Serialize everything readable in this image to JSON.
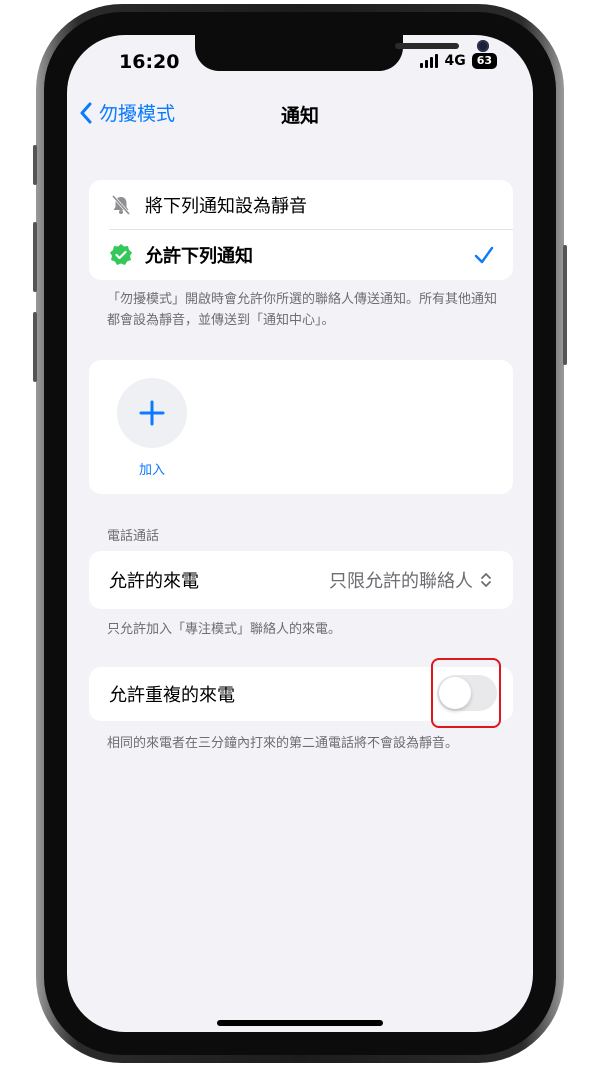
{
  "status": {
    "time": "16:20",
    "network": "4G",
    "battery": "63"
  },
  "nav": {
    "back_label": "勿擾模式",
    "title": "通知"
  },
  "mode_options": [
    {
      "label": "將下列通知設為靜音",
      "icon": "bell-slash-icon",
      "selected": false
    },
    {
      "label": "允許下列通知",
      "icon": "checkmark-seal-icon",
      "selected": true
    }
  ],
  "mode_footnote": "「勿擾模式」開啟時會允許你所選的聯絡人傳送通知。所有其他通知都會設為靜音，並傳送到「通知中心」。",
  "people": {
    "add_label": "加入",
    "add_icon": "plus-icon"
  },
  "calls_section": {
    "header": "電話通話",
    "allowed_calls_label": "允許的來電",
    "allowed_calls_value": "只限允許的聯絡人",
    "footnote": "只允許加入「專注模式」聯絡人的來電。"
  },
  "repeated_calls": {
    "label": "允許重複的來電",
    "enabled": false,
    "footnote": "相同的來電者在三分鐘內打來的第二通電話將不會設為靜音。"
  },
  "colors": {
    "accent": "#0a7aff",
    "highlight": "#e0161e",
    "check_badge": "#34c759"
  }
}
